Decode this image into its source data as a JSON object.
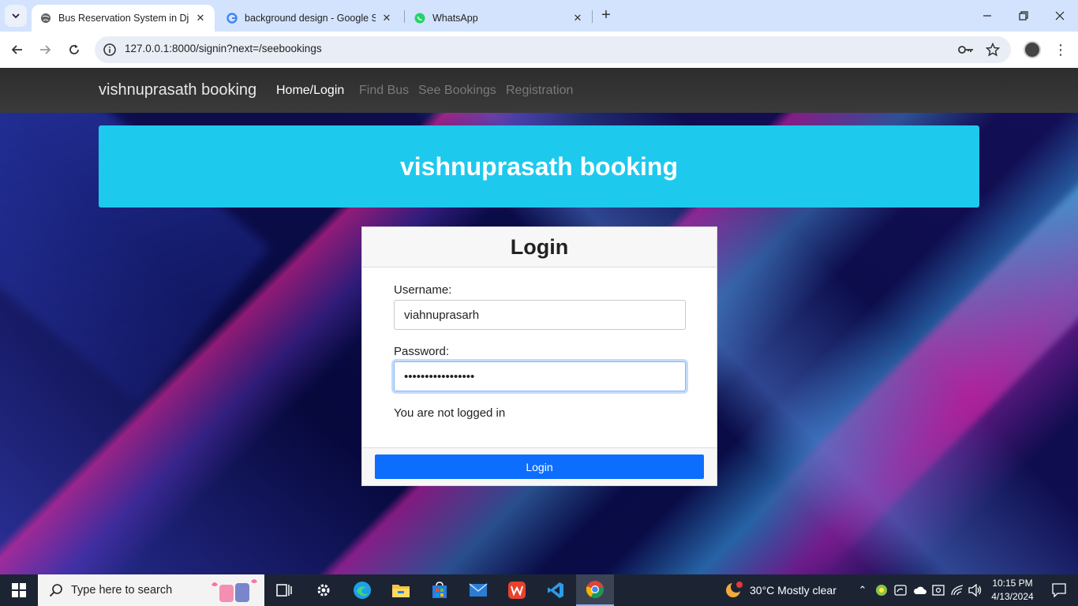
{
  "browser": {
    "tabs": [
      {
        "title": "Bus Reservation System in Djan",
        "active": true
      },
      {
        "title": "background design - Google Se",
        "active": false
      },
      {
        "title": "WhatsApp",
        "active": false
      }
    ],
    "url": "127.0.0.1:8000/signin?next=/seebookings"
  },
  "navbar": {
    "brand": "vishnuprasath booking",
    "links": [
      "Home/Login",
      "Find Bus",
      "See Bookings",
      "Registration"
    ]
  },
  "banner": {
    "title": "vishnuprasath booking"
  },
  "login": {
    "heading": "Login",
    "username_label": "Username:",
    "username_value": "viahnuprasarh",
    "password_label": "Password:",
    "password_value": "•••••••••••••••••",
    "status": "You are not logged in",
    "button": "Login"
  },
  "taskbar": {
    "search_placeholder": "Type here to search",
    "weather": "30°C  Mostly clear",
    "time": "10:15 PM",
    "date": "4/13/2024"
  },
  "colors": {
    "accent": "#0d6efd",
    "banner": "#1ec9ee",
    "navbar": "#343434"
  }
}
